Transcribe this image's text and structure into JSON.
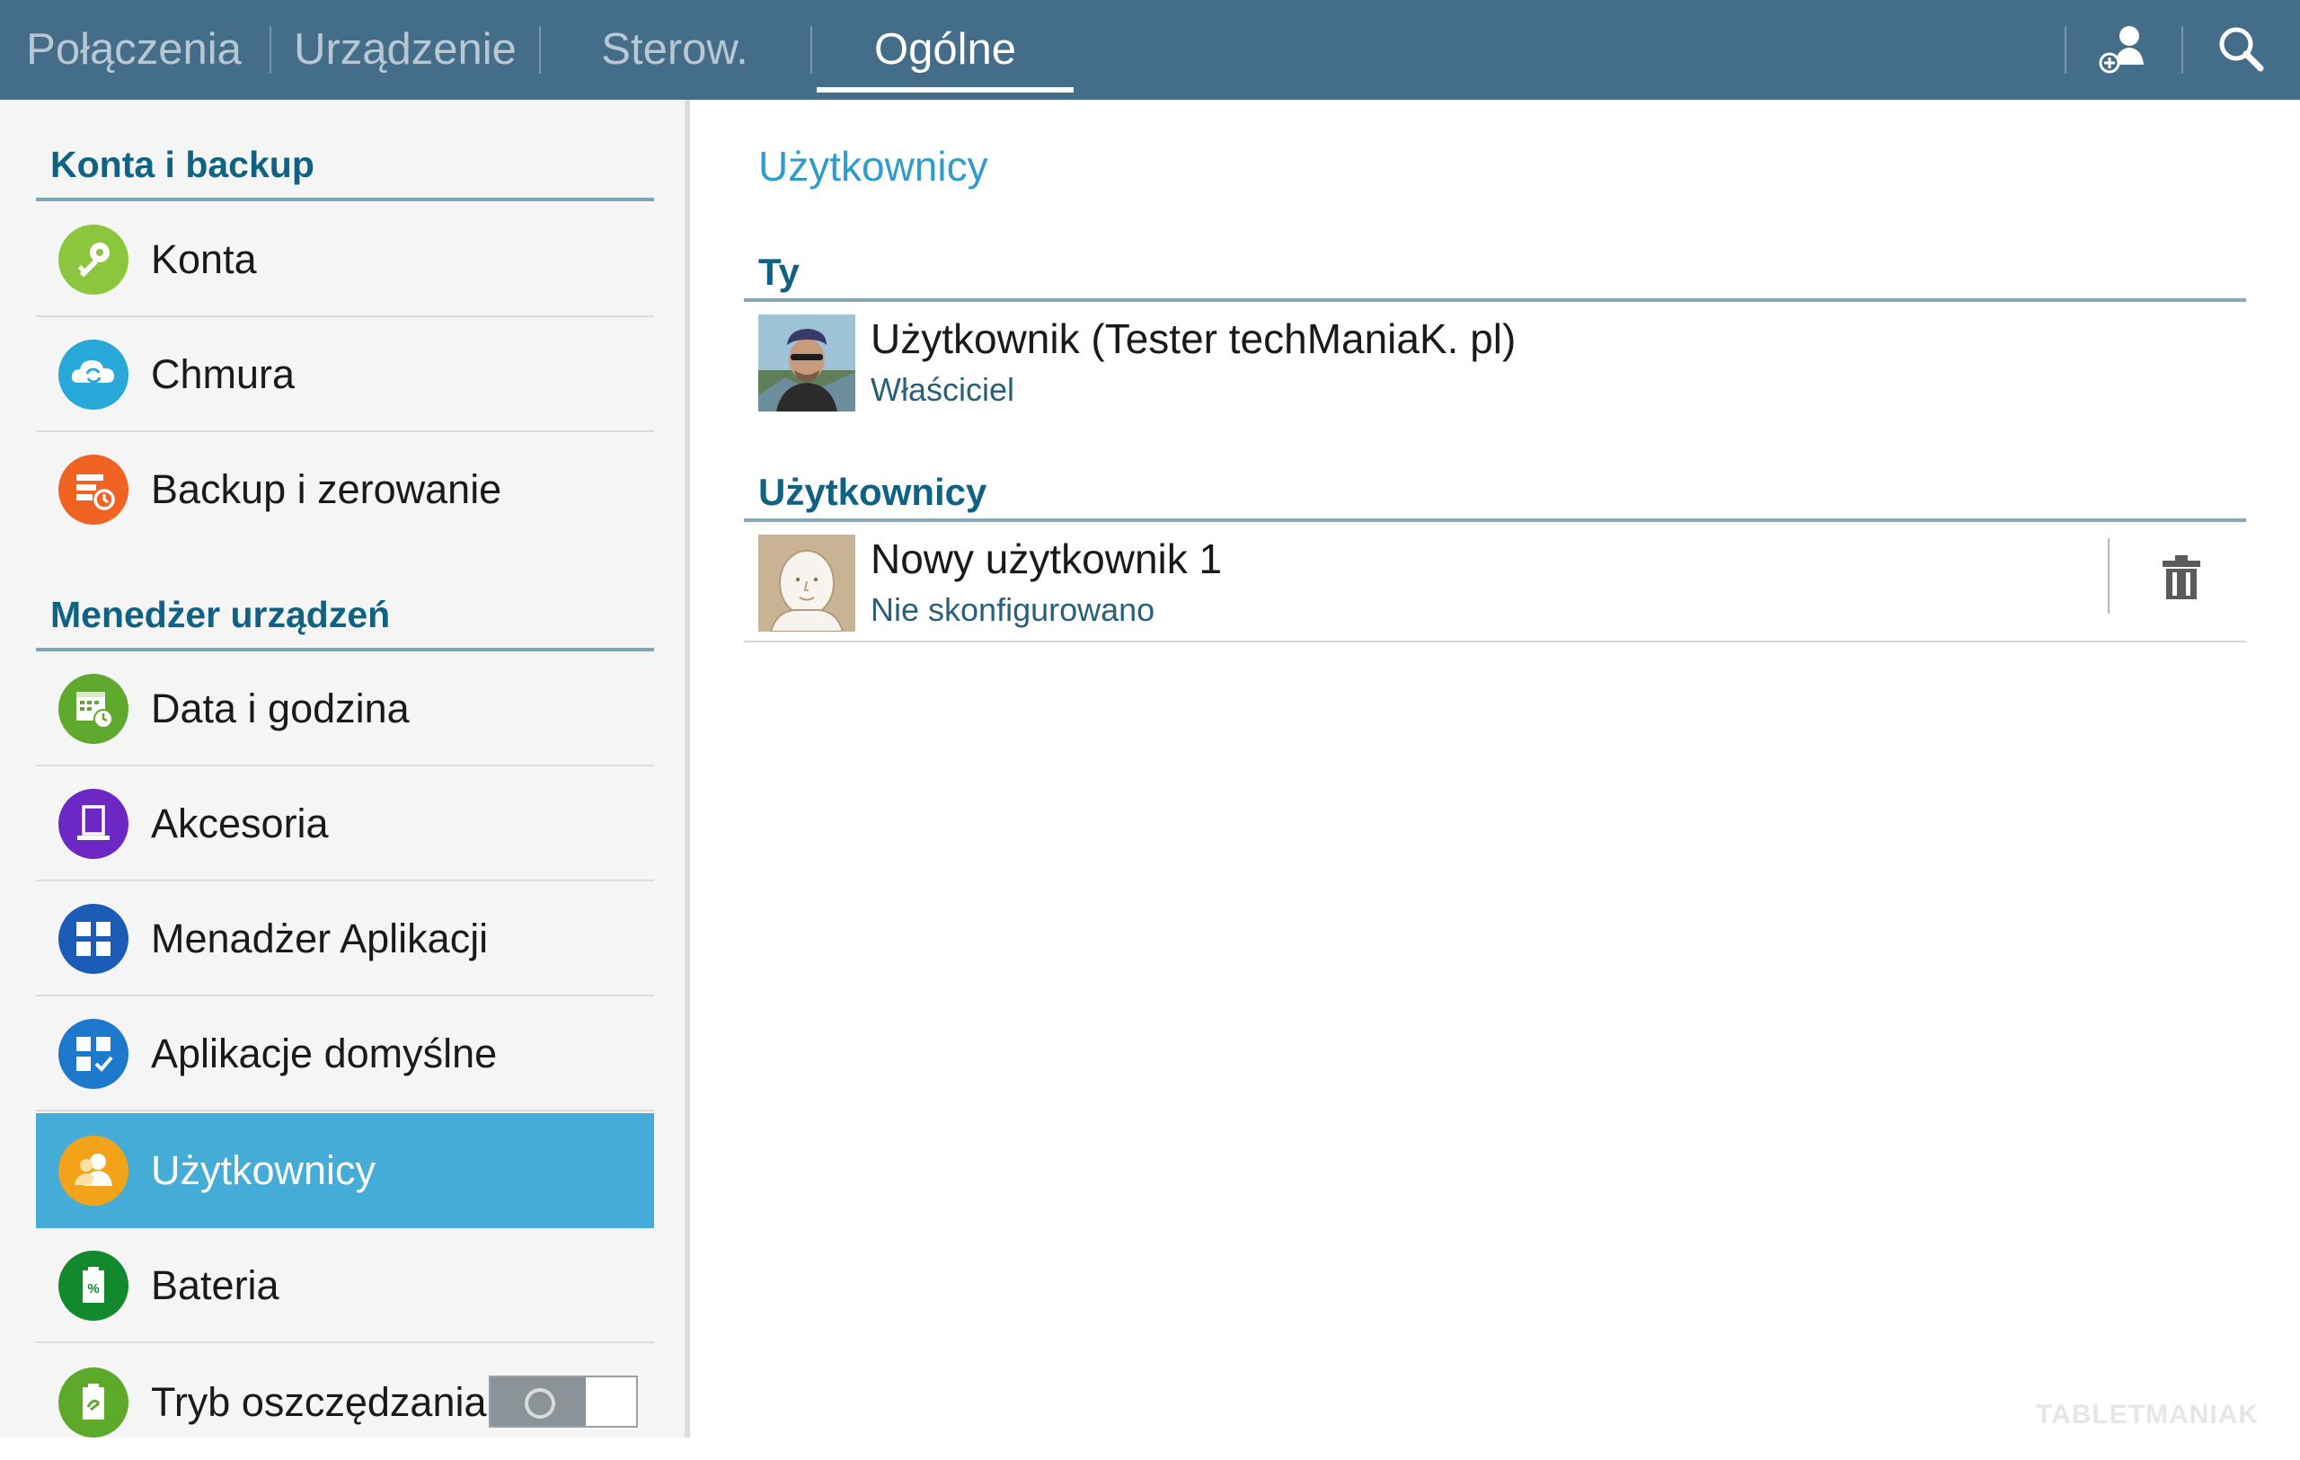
{
  "tabs": [
    {
      "label": "Połączenia"
    },
    {
      "label": "Urządzenie"
    },
    {
      "label": "Sterow."
    },
    {
      "label": "Ogólne",
      "active": true
    }
  ],
  "toolbar": {
    "add_user_icon": "add-user-icon",
    "search_icon": "search-icon"
  },
  "sidebar": {
    "sections": [
      {
        "title": "Konta i backup",
        "items": [
          {
            "label": "Konta",
            "icon": "key-icon",
            "color": "#8cc63f"
          },
          {
            "label": "Chmura",
            "icon": "cloud-sync-icon",
            "color": "#27a8d8"
          },
          {
            "label": "Backup i zerowanie",
            "icon": "backup-icon",
            "color": "#f06322"
          }
        ]
      },
      {
        "title": "Menedżer urządzeń",
        "items": [
          {
            "label": "Data i godzina",
            "icon": "calendar-clock-icon",
            "color": "#5fa92e"
          },
          {
            "label": "Akcesoria",
            "icon": "accessory-icon",
            "color": "#6c27c4"
          },
          {
            "label": "Menadżer Aplikacji",
            "icon": "app-grid-icon",
            "color": "#1a5cb6"
          },
          {
            "label": "Aplikacje domyślne",
            "icon": "default-apps-icon",
            "color": "#1d79cc"
          },
          {
            "label": "Użytkownicy",
            "icon": "users-icon",
            "color": "#f2a31a",
            "selected": true
          },
          {
            "label": "Bateria",
            "icon": "battery-icon",
            "color": "#12892c"
          },
          {
            "label": "Tryb oszczędzania",
            "icon": "power-saving-icon",
            "color": "#5daa2a",
            "toggle": false
          }
        ]
      }
    ]
  },
  "content": {
    "title": "Użytkownicy",
    "you_header": "Ty",
    "owner": {
      "name": "Użytkownik (Tester techManiaK. pl)",
      "role": "Właściciel"
    },
    "users_header": "Użytkownicy",
    "users": [
      {
        "name": "Nowy użytkownik 1",
        "status": "Nie skonfigurowano"
      }
    ]
  },
  "watermark": "TABLETMANIAK",
  "colors": {
    "topbar": "#446d89",
    "accent": "#2f9ccb",
    "header_text": "#0f6284",
    "selected_bg": "#45acd8"
  }
}
